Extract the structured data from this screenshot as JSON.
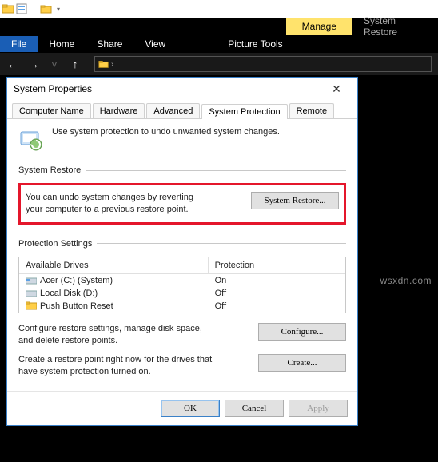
{
  "explorer": {
    "ribbon": {
      "file": "File",
      "home": "Home",
      "share": "Share",
      "view": "View",
      "manage": "Manage",
      "context_title": "System Restore",
      "picture_tools": "Picture Tools"
    }
  },
  "dialog": {
    "title": "System Properties",
    "tabs": {
      "computer_name": "Computer Name",
      "hardware": "Hardware",
      "advanced": "Advanced",
      "system_protection": "System Protection",
      "remote": "Remote"
    },
    "intro_text": "Use system protection to undo unwanted system changes.",
    "sr_group": "System Restore",
    "sr_text": "You can undo system changes by reverting your computer to a previous restore point.",
    "sr_button": "System Restore...",
    "ps_group": "Protection Settings",
    "drives_header": {
      "c1": "Available Drives",
      "c2": "Protection"
    },
    "drives": [
      {
        "name": "Acer (C:) (System)",
        "prot": "On",
        "icon": "hdd"
      },
      {
        "name": "Local Disk (D:)",
        "prot": "Off",
        "icon": "hdd"
      },
      {
        "name": "Push Button Reset",
        "prot": "Off",
        "icon": "folder"
      }
    ],
    "cfg_text": "Configure restore settings, manage disk space, and delete restore points.",
    "cfg_button": "Configure...",
    "create_text": "Create a restore point right now for the drives that have system protection turned on.",
    "create_button": "Create...",
    "footer": {
      "ok": "OK",
      "cancel": "Cancel",
      "apply": "Apply"
    }
  },
  "watermark": "wsxdn.com"
}
